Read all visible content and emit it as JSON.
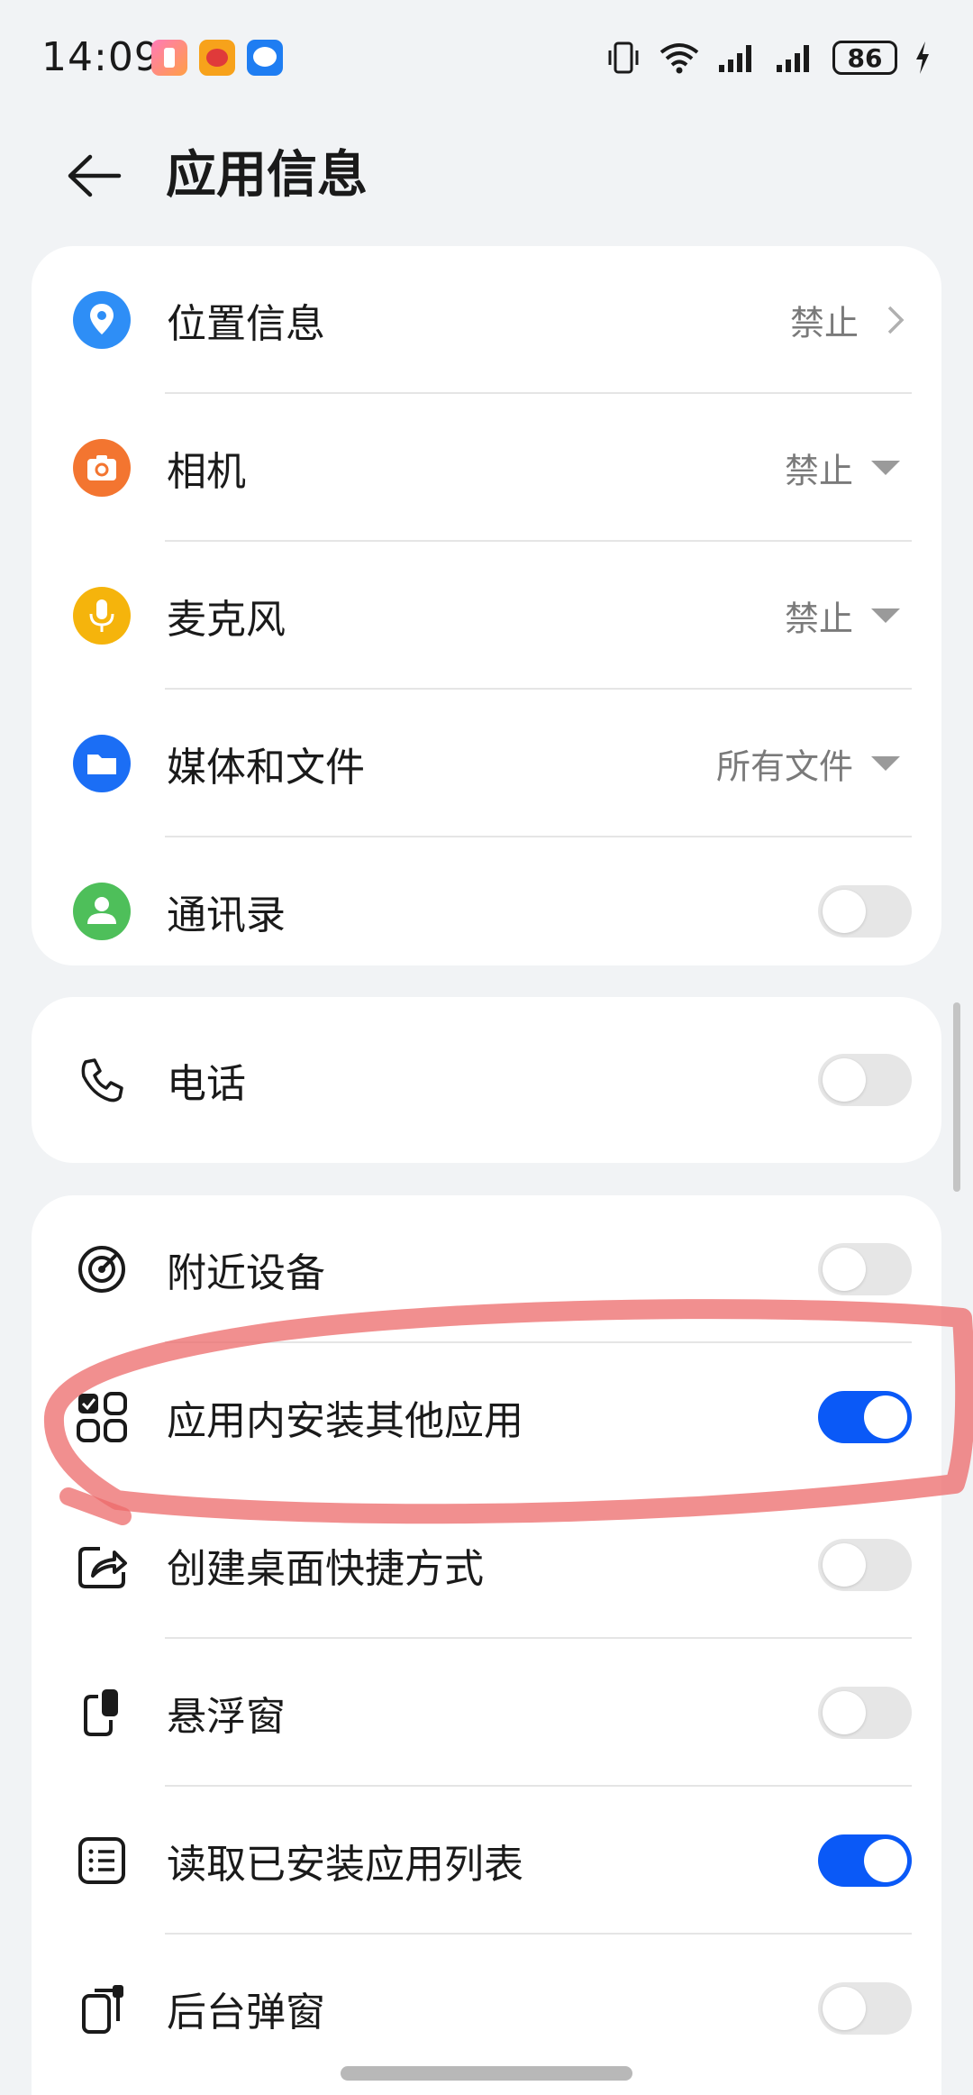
{
  "status_bar": {
    "time": "14:09",
    "battery_level": "86"
  },
  "header": {
    "title": "应用信息"
  },
  "permissions_group": [
    {
      "label": "位置信息",
      "value": "禁止",
      "control": "chevron",
      "icon": "location-icon",
      "color": "#2e8ef6"
    },
    {
      "label": "相机",
      "value": "禁止",
      "control": "dropdown",
      "icon": "camera-icon",
      "color": "#f37530"
    },
    {
      "label": "麦克风",
      "value": "禁止",
      "control": "dropdown",
      "icon": "microphone-icon",
      "color": "#f5b40c"
    },
    {
      "label": "媒体和文件",
      "value": "所有文件",
      "control": "dropdown",
      "icon": "folder-icon",
      "color": "#1b6ef5"
    },
    {
      "label": "通讯录",
      "control": "toggle",
      "enabled": false,
      "icon": "contacts-icon",
      "color": "#4ebf5a"
    }
  ],
  "phone_group": [
    {
      "label": "电话",
      "control": "toggle",
      "enabled": false,
      "icon": "phone-icon"
    }
  ],
  "other_group": [
    {
      "label": "附近设备",
      "control": "toggle",
      "enabled": false,
      "icon": "nearby-devices-icon"
    },
    {
      "label": "应用内安装其他应用",
      "control": "toggle",
      "enabled": true,
      "icon": "install-apps-icon"
    },
    {
      "label": "创建桌面快捷方式",
      "control": "toggle",
      "enabled": false,
      "icon": "shortcut-icon"
    },
    {
      "label": "悬浮窗",
      "control": "toggle",
      "enabled": false,
      "icon": "floating-window-icon"
    },
    {
      "label": "读取已安装应用列表",
      "control": "toggle",
      "enabled": true,
      "icon": "app-list-icon"
    },
    {
      "label": "后台弹窗",
      "control": "toggle",
      "enabled": false,
      "icon": "background-popup-icon"
    }
  ],
  "colors": {
    "accent": "#0a59f7",
    "toggle_off": "#e6e6e6",
    "annotation": "#ec6a6a"
  }
}
